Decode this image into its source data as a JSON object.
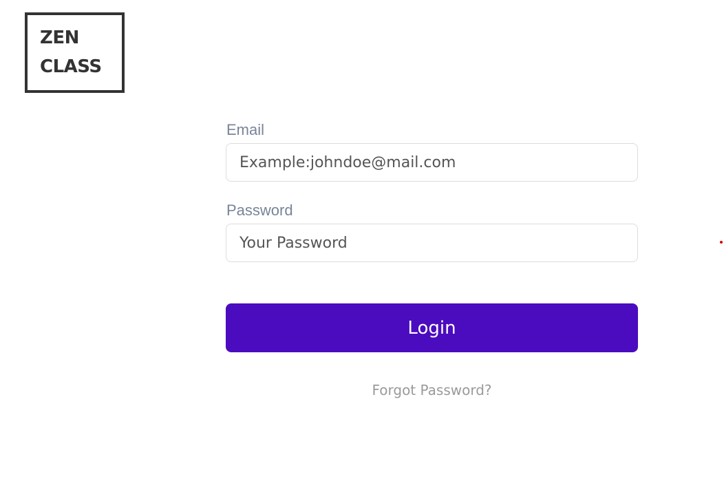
{
  "logo": {
    "line1": "ZEN",
    "line2": "CLASS"
  },
  "form": {
    "email_label": "Email",
    "email_placeholder": "Example:johndoe@mail.com",
    "email_value": "",
    "password_label": "Password",
    "password_placeholder": "Your Password",
    "password_value": "",
    "login_label": "Login",
    "forgot_label": "Forgot Password?"
  },
  "colors": {
    "accent": "#4b0cbf",
    "label": "#788497",
    "link": "#9a9a9a",
    "indicator": "#d40000"
  }
}
